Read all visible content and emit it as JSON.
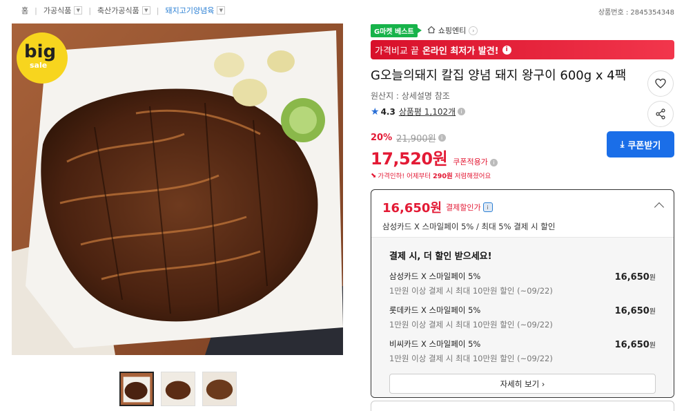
{
  "breadcrumb": {
    "home": "홈",
    "items": [
      {
        "label": "가공식품"
      },
      {
        "label": "축산가공식품"
      },
      {
        "label": "돼지고기양념육"
      }
    ],
    "product_id": "상품번호 : 2845354348"
  },
  "product": {
    "image_badge": {
      "big": "big",
      "sale": "sale"
    },
    "thumbnail_count": 3,
    "best_badge": "G마켓 베스트",
    "shop_name": "쇼핑엔티",
    "banner": {
      "prefix": "가격비교 끝",
      "bold": "온라인 최저가 발견!"
    },
    "title": "G오늘의돼지 칼집 양념 돼지 왕구이 600g x 4팩",
    "origin": "원산지 : 상세설명 참조",
    "rating": "4.3",
    "review_label": "상품평 1,102개",
    "discount_pct": "20%",
    "original_price": "21,900원",
    "price": "17,520원",
    "coupon_note": "쿠폰적용가",
    "drop_note_pre": "가격인하! 어제부터",
    "drop_amount": "290원",
    "drop_note_post": "저렴해졌어요",
    "coupon_button": "쿠폰받기"
  },
  "payment": {
    "price": "16,650원",
    "label": "결제할인가",
    "summary": "삼성카드 X 스마일페이 5% / 최대 5% 결제 시 할인",
    "detail_heading": "결제 시, 더 할인 받으세요!",
    "cards": [
      {
        "name": "삼성카드 X 스마일페이 5%",
        "sub": "1만원 이상 결제 시 최대 10만원 할인 (~09/22)",
        "amount": "16,650",
        "unit": "원"
      },
      {
        "name": "롯데카드 X 스마일페이 5%",
        "sub": "1만원 이상 결제 시 최대 10만원 할인 (~09/22)",
        "amount": "16,650",
        "unit": "원"
      },
      {
        "name": "비씨카드 X 스마일페이 5%",
        "sub": "1만원 이상 결제 시 최대 10만원 할인 (~09/22)",
        "amount": "16,650",
        "unit": "원"
      }
    ],
    "more_button": "자세히 보기 ›"
  },
  "colors": {
    "accent_red": "#e31a35",
    "accent_blue": "#1a6ee8",
    "best_green": "#17b34a"
  }
}
